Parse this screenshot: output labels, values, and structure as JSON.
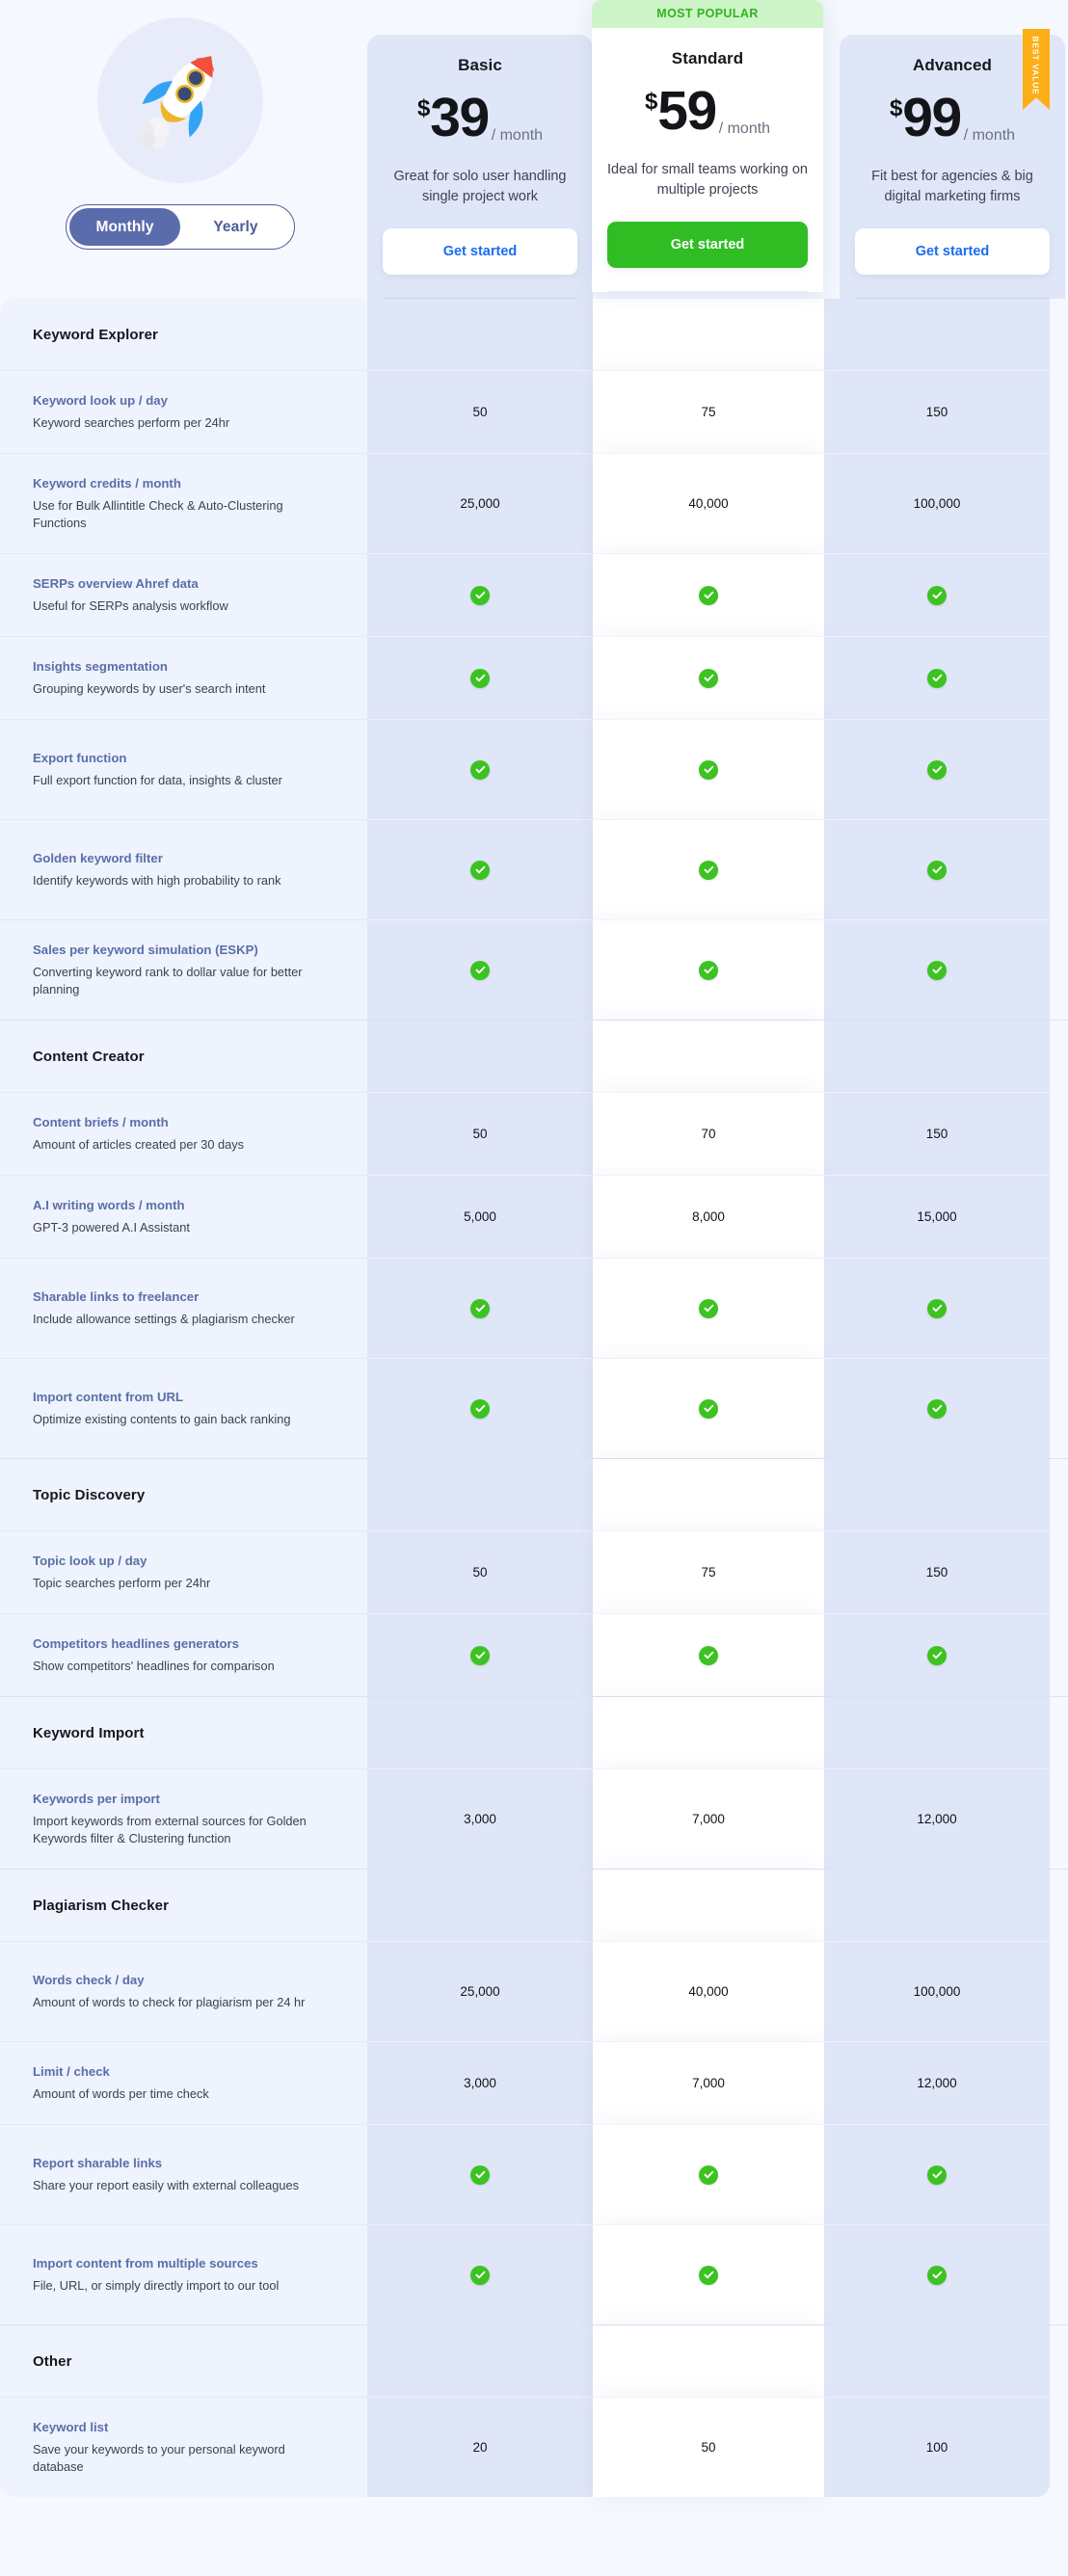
{
  "hero": {
    "rocket_icon": "rocket-illustration",
    "billing": {
      "monthly_label": "Monthly",
      "yearly_label": "Yearly",
      "selected": "Monthly"
    }
  },
  "badges": {
    "most_popular": "MOST POPULAR",
    "best_value": "BEST VALUE"
  },
  "colors": {
    "accent_blue": "#5a6cab",
    "cta_green": "#2fbd23",
    "check_green": "#3cc321",
    "ribbon_orange": "#fcae17",
    "page_bg": "#f5f8fe",
    "column_bg": "#dfe6f7",
    "label_bg": "#eef3fd",
    "link_blue": "#1a6cf1",
    "feature_name": "#5b6ea8"
  },
  "plans": [
    {
      "id": "basic",
      "name": "Basic",
      "currency": "$",
      "price": "39",
      "period": "/ month",
      "description": "Great for solo user handling single project work",
      "cta_label": "Get started",
      "highlight": false,
      "ribbon": null
    },
    {
      "id": "standard",
      "name": "Standard",
      "currency": "$",
      "price": "59",
      "period": "/ month",
      "description": "Ideal for small teams working on multiple projects",
      "cta_label": "Get started",
      "highlight": true,
      "ribbon": null
    },
    {
      "id": "advanced",
      "name": "Advanced",
      "currency": "$",
      "price": "99",
      "period": "/ month",
      "description": "Fit best for agencies & big digital marketing firms",
      "cta_label": "Get started",
      "highlight": false,
      "ribbon": "BEST VALUE"
    }
  ],
  "sections": [
    {
      "title": "Keyword Explorer",
      "features": [
        {
          "name": "Keyword look up / day",
          "desc": "Keyword searches perform per 24hr",
          "values": [
            "50",
            "75",
            "150"
          ],
          "type": "text"
        },
        {
          "name": "Keyword credits / month",
          "desc": "Use for Bulk Allintitle Check & Auto-Clustering Functions",
          "values": [
            "25,000",
            "40,000",
            "100,000"
          ],
          "type": "text"
        },
        {
          "name": "SERPs overview Ahref data",
          "desc": "Useful for SERPs analysis workflow",
          "values": [
            "check",
            "check",
            "check"
          ],
          "type": "check"
        },
        {
          "name": "Insights segmentation",
          "desc": "Grouping keywords by user's search intent",
          "values": [
            "check",
            "check",
            "check"
          ],
          "type": "check"
        },
        {
          "name": "Export function",
          "desc": "Full export function for data, insights & cluster",
          "values": [
            "check",
            "check",
            "check"
          ],
          "type": "check"
        },
        {
          "name": "Golden keyword filter",
          "desc": "Identify keywords with high probability to rank",
          "values": [
            "check",
            "check",
            "check"
          ],
          "type": "check"
        },
        {
          "name": "Sales per keyword simulation (ESKP)",
          "desc": "Converting keyword rank to dollar value for better planning",
          "values": [
            "check",
            "check",
            "check"
          ],
          "type": "check"
        }
      ]
    },
    {
      "title": "Content Creator",
      "features": [
        {
          "name": "Content briefs / month",
          "desc": "Amount of articles created per 30 days",
          "values": [
            "50",
            "70",
            "150"
          ],
          "type": "text"
        },
        {
          "name": "A.I writing words / month",
          "desc": "GPT-3 powered A.I Assistant",
          "values": [
            "5,000",
            "8,000",
            "15,000"
          ],
          "type": "text"
        },
        {
          "name": "Sharable links to freelancer",
          "desc": "Include allowance settings & plagiarism checker",
          "values": [
            "check",
            "check",
            "check"
          ],
          "type": "check"
        },
        {
          "name": "Import content from URL",
          "desc": "Optimize existing contents to gain back ranking",
          "values": [
            "check",
            "check",
            "check"
          ],
          "type": "check"
        }
      ]
    },
    {
      "title": "Topic Discovery",
      "features": [
        {
          "name": "Topic look up / day",
          "desc": "Topic searches perform per 24hr",
          "values": [
            "50",
            "75",
            "150"
          ],
          "type": "text"
        },
        {
          "name": "Competitors headlines generators",
          "desc": "Show competitors' headlines for comparison",
          "values": [
            "check",
            "check",
            "check"
          ],
          "type": "check"
        }
      ]
    },
    {
      "title": "Keyword Import",
      "features": [
        {
          "name": "Keywords per import",
          "desc": "Import keywords from external sources for Golden Keywords filter & Clustering function",
          "values": [
            "3,000",
            "7,000",
            "12,000"
          ],
          "type": "text"
        }
      ]
    },
    {
      "title": "Plagiarism Checker",
      "features": [
        {
          "name": "Words check / day",
          "desc": "Amount of words to check for plagiarism per 24 hr",
          "values": [
            "25,000",
            "40,000",
            "100,000"
          ],
          "type": "text"
        },
        {
          "name": "Limit / check",
          "desc": "Amount of words per time check",
          "values": [
            "3,000",
            "7,000",
            "12,000"
          ],
          "type": "text"
        },
        {
          "name": "Report sharable links",
          "desc": "Share your report easily with external colleagues",
          "values": [
            "check",
            "check",
            "check"
          ],
          "type": "check"
        },
        {
          "name": "Import content from multiple sources",
          "desc": "File, URL, or simply directly import to our tool",
          "values": [
            "check",
            "check",
            "check"
          ],
          "type": "check"
        }
      ]
    },
    {
      "title": "Other",
      "features": [
        {
          "name": "Keyword list",
          "desc": "Save your keywords to your personal keyword database",
          "values": [
            "20",
            "50",
            "100"
          ],
          "type": "text"
        }
      ]
    }
  ]
}
